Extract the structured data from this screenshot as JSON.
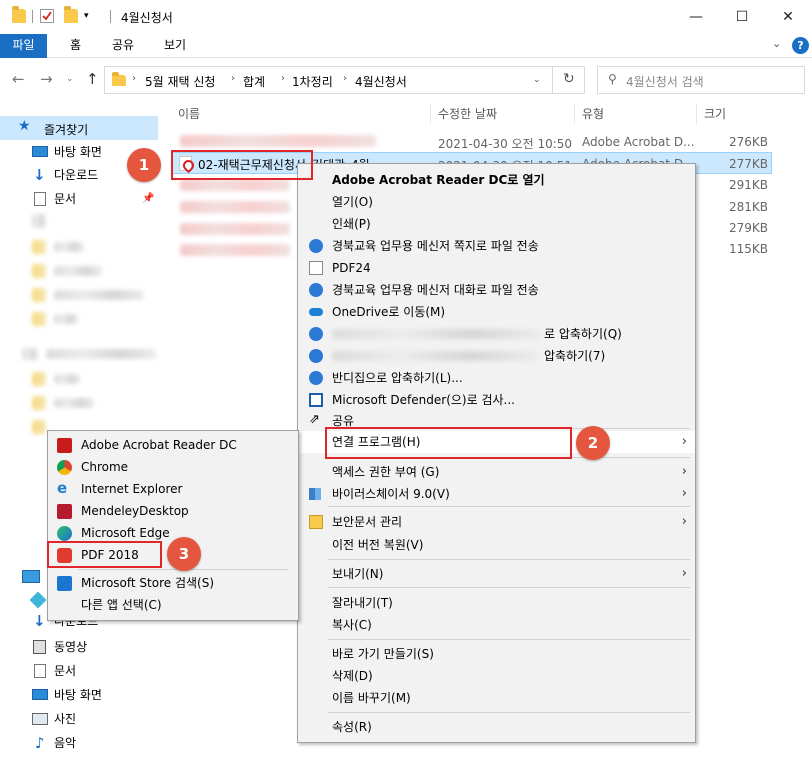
{
  "window": {
    "title": "4월신청서",
    "minimize": "—",
    "maximize": "☐",
    "close": "✕"
  },
  "ribbon": {
    "tabs": [
      "파일",
      "홈",
      "공유",
      "보기"
    ],
    "collapse": "⌄",
    "help": "?"
  },
  "address": {
    "parts": [
      "5월 재택 신청",
      "합계",
      "1차정리",
      "4월신청서"
    ],
    "search_placeholder": "4월신청서 검색",
    "refresh": "↻"
  },
  "sidebar": {
    "quick_access": "즐겨찾기",
    "items": [
      "바탕 화면",
      "다운로드",
      "문서"
    ],
    "bottom_items": [
      "다운로드",
      "동영상",
      "문서",
      "바탕 화면",
      "사진",
      "음악"
    ]
  },
  "columns": {
    "name": "이름",
    "date": "수정한 날짜",
    "type": "유형",
    "size": "크기"
  },
  "files": [
    {
      "name": "",
      "date": "2021-04-30 오전 10:50",
      "type": "Adobe Acrobat D...",
      "size": "276KB"
    },
    {
      "name": "02-재택근무제신청서_김태관_4월",
      "date": "2021-04-30 오전 10:51",
      "type": "Adobe Acrobat D...",
      "size": "277KB"
    },
    {
      "name": "",
      "date": "",
      "type": "",
      "size": "291KB"
    },
    {
      "name": "",
      "date": "",
      "type": "",
      "size": "281KB"
    },
    {
      "name": "",
      "date": "",
      "type": "",
      "size": "279KB"
    },
    {
      "name": "",
      "date": "",
      "type": "",
      "size": "115KB"
    }
  ],
  "context_menu": {
    "open_with_default": "Adobe Acrobat Reader DC로 열기",
    "open": "열기(O)",
    "print": "인쇄(P)",
    "messenger_note": "경북교육 업무용 메신저 쪽지로 파일 전송",
    "pdf24": "PDF24",
    "messenger_chat": "경북교육 업무용 메신저 대화로 파일 전송",
    "onedrive": "OneDrive로 이동(M)",
    "compress1": "로 압축하기(Q)",
    "compress2": "압축하기(7)",
    "bandizip": "반디집으로 압축하기(L)...",
    "defender": "Microsoft Defender(으)로 검사...",
    "share": "공유",
    "open_with": "연결 프로그램(H)",
    "grant_access": "액세스 권한 부여 (G)",
    "virus_chaser": "바이러스체이서 9.0(V)",
    "security_doc": "보안문서 관리",
    "restore": "이전 버전 복원(V)",
    "send_to": "보내기(N)",
    "cut": "잘라내기(T)",
    "copy": "복사(C)",
    "shortcut": "바로 가기 만들기(S)",
    "delete": "삭제(D)",
    "rename": "이름 바꾸기(M)",
    "properties": "속성(R)",
    "arrow": "›"
  },
  "open_with_menu": {
    "items": [
      "Adobe Acrobat Reader DC",
      "Chrome",
      "Internet Explorer",
      "MendeleyDesktop",
      "Microsoft Edge",
      "PDF 2018"
    ],
    "store": "Microsoft Store 검색(S)",
    "other": "다른 앱 선택(C)"
  },
  "annotations": {
    "step1": "1",
    "step2": "2",
    "step3": "3"
  },
  "colors": {
    "accent": "#1a6fc4",
    "highlight": "#e0262a",
    "badge": "#e4563e",
    "selection": "#cce8ff"
  }
}
